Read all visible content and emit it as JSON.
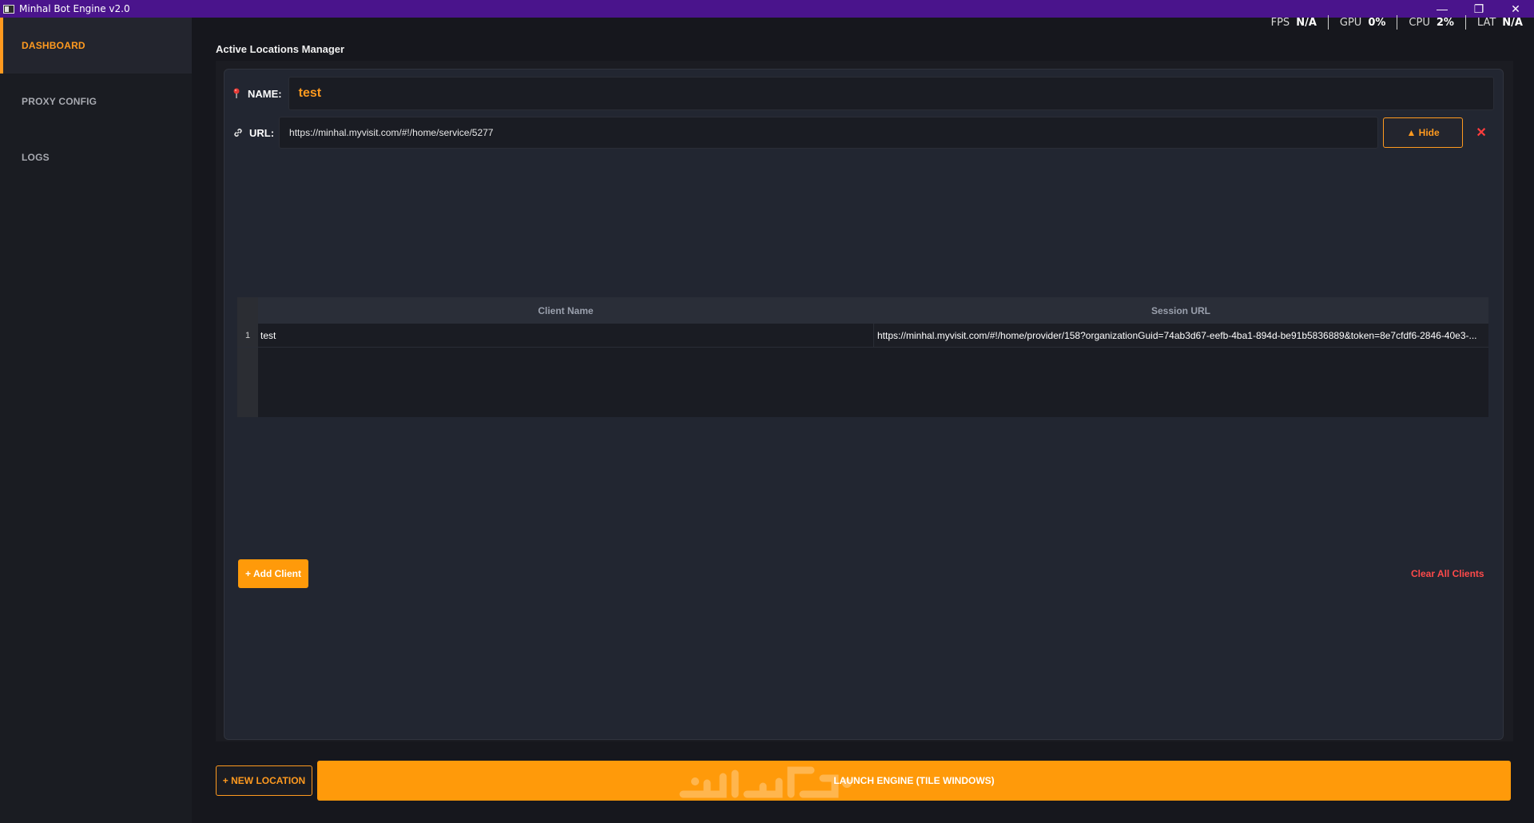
{
  "window": {
    "title": "Minhal Bot Engine v2.0",
    "controls": {
      "minimize": "—",
      "restore": "❐",
      "close": "✕"
    }
  },
  "metrics": [
    {
      "label": "FPS",
      "value": "N/A"
    },
    {
      "label": "GPU",
      "value": "0%"
    },
    {
      "label": "CPU",
      "value": "2%"
    },
    {
      "label": "LAT",
      "value": "N/A"
    }
  ],
  "sidebar": {
    "items": [
      {
        "label": "DASHBOARD",
        "active": true
      },
      {
        "label": "PROXY CONFIG",
        "active": false
      },
      {
        "label": "LOGS",
        "active": false
      }
    ]
  },
  "main": {
    "section_title": "Active Locations Manager",
    "location": {
      "name_label": "NAME:",
      "name_value": "test",
      "url_label": "URL:",
      "url_value": "https://minhal.myvisit.com/#!/home/service/5277",
      "hide_label": "▲ Hide",
      "remove_icon": "✕"
    },
    "table": {
      "columns": [
        "Client Name",
        "Session URL"
      ],
      "rows": [
        {
          "num": "1",
          "client_name": "test",
          "session_url": "https://minhal.myvisit.com/#!/home/provider/158?organizationGuid=74ab3d67-eefb-4ba1-894d-be91b5836889&token=8e7cfdf6-2846-40e3-..."
        }
      ]
    },
    "add_client_label": "+ Add Client",
    "clear_all_label": "Clear All Clients"
  },
  "footer": {
    "new_location_label": "+ NEW LOCATION",
    "launch_engine_label": "LAUNCH ENGINE (TILE WINDOWS)"
  },
  "colors": {
    "accent": "#ff9a1f",
    "titlebar": "#4a148c",
    "danger": "#ff4a4a",
    "background": "#16171d"
  },
  "icons": [
    "app-icon",
    "pin-icon",
    "link-icon",
    "close-icon",
    "minimize-icon",
    "restore-icon"
  ]
}
